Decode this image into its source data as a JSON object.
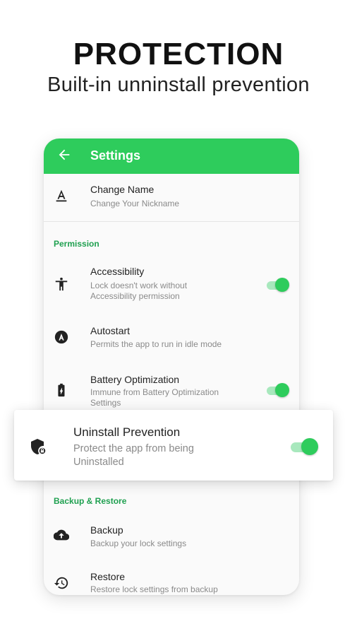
{
  "promo": {
    "headline": "PROTECTION",
    "subline": "Built-in unninstall prevention"
  },
  "colors": {
    "accent": "#2ecc5c",
    "section": "#1fa050"
  },
  "appbar": {
    "title": "Settings",
    "back_icon": "arrow-left-icon"
  },
  "rows": {
    "change_name": {
      "title": "Change Name",
      "subtitle": "Change Your Nickname",
      "icon": "text-format-icon"
    },
    "accessibility": {
      "title": "Accessibility",
      "subtitle": "Lock doesn't work without Accessibility permission",
      "icon": "accessibility-icon",
      "enabled": true
    },
    "autostart": {
      "title": "Autostart",
      "subtitle": "Permits the app to run in idle mode",
      "icon": "autostart-icon"
    },
    "battery": {
      "title": "Battery Optimization",
      "subtitle": "Immune from Battery Optimization Settings",
      "icon": "battery-icon",
      "enabled": true
    },
    "backup": {
      "title": "Backup",
      "subtitle": "Backup your lock settings",
      "icon": "cloud-upload-icon"
    },
    "restore": {
      "title": "Restore",
      "subtitle": "Restore lock settings from backup",
      "icon": "restore-icon"
    }
  },
  "sections": {
    "permission": "Permission",
    "backup_restore": "Backup & Restore"
  },
  "popup": {
    "title": "Uninstall Prevention",
    "subtitle": "Protect the app from being Uninstalled",
    "icon": "shield-lock-icon",
    "enabled": true
  }
}
